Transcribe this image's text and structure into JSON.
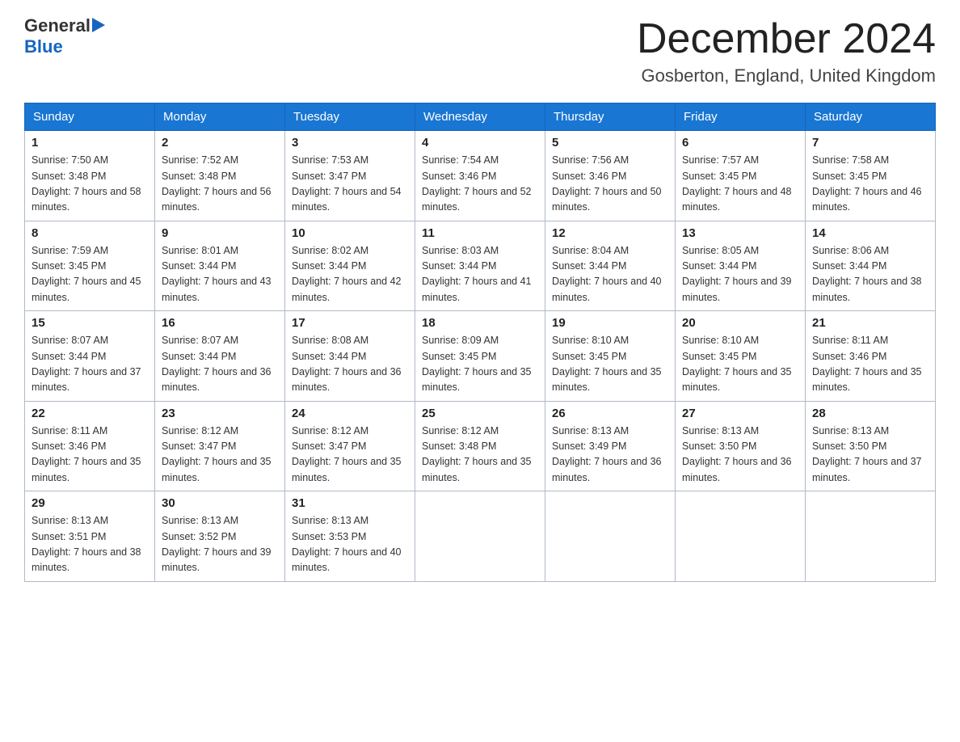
{
  "header": {
    "logo_general": "General",
    "logo_blue": "Blue",
    "month_title": "December 2024",
    "location": "Gosberton, England, United Kingdom"
  },
  "days_of_week": [
    "Sunday",
    "Monday",
    "Tuesday",
    "Wednesday",
    "Thursday",
    "Friday",
    "Saturday"
  ],
  "weeks": [
    [
      {
        "day": "1",
        "sunrise": "Sunrise: 7:50 AM",
        "sunset": "Sunset: 3:48 PM",
        "daylight": "Daylight: 7 hours and 58 minutes."
      },
      {
        "day": "2",
        "sunrise": "Sunrise: 7:52 AM",
        "sunset": "Sunset: 3:48 PM",
        "daylight": "Daylight: 7 hours and 56 minutes."
      },
      {
        "day": "3",
        "sunrise": "Sunrise: 7:53 AM",
        "sunset": "Sunset: 3:47 PM",
        "daylight": "Daylight: 7 hours and 54 minutes."
      },
      {
        "day": "4",
        "sunrise": "Sunrise: 7:54 AM",
        "sunset": "Sunset: 3:46 PM",
        "daylight": "Daylight: 7 hours and 52 minutes."
      },
      {
        "day": "5",
        "sunrise": "Sunrise: 7:56 AM",
        "sunset": "Sunset: 3:46 PM",
        "daylight": "Daylight: 7 hours and 50 minutes."
      },
      {
        "day": "6",
        "sunrise": "Sunrise: 7:57 AM",
        "sunset": "Sunset: 3:45 PM",
        "daylight": "Daylight: 7 hours and 48 minutes."
      },
      {
        "day": "7",
        "sunrise": "Sunrise: 7:58 AM",
        "sunset": "Sunset: 3:45 PM",
        "daylight": "Daylight: 7 hours and 46 minutes."
      }
    ],
    [
      {
        "day": "8",
        "sunrise": "Sunrise: 7:59 AM",
        "sunset": "Sunset: 3:45 PM",
        "daylight": "Daylight: 7 hours and 45 minutes."
      },
      {
        "day": "9",
        "sunrise": "Sunrise: 8:01 AM",
        "sunset": "Sunset: 3:44 PM",
        "daylight": "Daylight: 7 hours and 43 minutes."
      },
      {
        "day": "10",
        "sunrise": "Sunrise: 8:02 AM",
        "sunset": "Sunset: 3:44 PM",
        "daylight": "Daylight: 7 hours and 42 minutes."
      },
      {
        "day": "11",
        "sunrise": "Sunrise: 8:03 AM",
        "sunset": "Sunset: 3:44 PM",
        "daylight": "Daylight: 7 hours and 41 minutes."
      },
      {
        "day": "12",
        "sunrise": "Sunrise: 8:04 AM",
        "sunset": "Sunset: 3:44 PM",
        "daylight": "Daylight: 7 hours and 40 minutes."
      },
      {
        "day": "13",
        "sunrise": "Sunrise: 8:05 AM",
        "sunset": "Sunset: 3:44 PM",
        "daylight": "Daylight: 7 hours and 39 minutes."
      },
      {
        "day": "14",
        "sunrise": "Sunrise: 8:06 AM",
        "sunset": "Sunset: 3:44 PM",
        "daylight": "Daylight: 7 hours and 38 minutes."
      }
    ],
    [
      {
        "day": "15",
        "sunrise": "Sunrise: 8:07 AM",
        "sunset": "Sunset: 3:44 PM",
        "daylight": "Daylight: 7 hours and 37 minutes."
      },
      {
        "day": "16",
        "sunrise": "Sunrise: 8:07 AM",
        "sunset": "Sunset: 3:44 PM",
        "daylight": "Daylight: 7 hours and 36 minutes."
      },
      {
        "day": "17",
        "sunrise": "Sunrise: 8:08 AM",
        "sunset": "Sunset: 3:44 PM",
        "daylight": "Daylight: 7 hours and 36 minutes."
      },
      {
        "day": "18",
        "sunrise": "Sunrise: 8:09 AM",
        "sunset": "Sunset: 3:45 PM",
        "daylight": "Daylight: 7 hours and 35 minutes."
      },
      {
        "day": "19",
        "sunrise": "Sunrise: 8:10 AM",
        "sunset": "Sunset: 3:45 PM",
        "daylight": "Daylight: 7 hours and 35 minutes."
      },
      {
        "day": "20",
        "sunrise": "Sunrise: 8:10 AM",
        "sunset": "Sunset: 3:45 PM",
        "daylight": "Daylight: 7 hours and 35 minutes."
      },
      {
        "day": "21",
        "sunrise": "Sunrise: 8:11 AM",
        "sunset": "Sunset: 3:46 PM",
        "daylight": "Daylight: 7 hours and 35 minutes."
      }
    ],
    [
      {
        "day": "22",
        "sunrise": "Sunrise: 8:11 AM",
        "sunset": "Sunset: 3:46 PM",
        "daylight": "Daylight: 7 hours and 35 minutes."
      },
      {
        "day": "23",
        "sunrise": "Sunrise: 8:12 AM",
        "sunset": "Sunset: 3:47 PM",
        "daylight": "Daylight: 7 hours and 35 minutes."
      },
      {
        "day": "24",
        "sunrise": "Sunrise: 8:12 AM",
        "sunset": "Sunset: 3:47 PM",
        "daylight": "Daylight: 7 hours and 35 minutes."
      },
      {
        "day": "25",
        "sunrise": "Sunrise: 8:12 AM",
        "sunset": "Sunset: 3:48 PM",
        "daylight": "Daylight: 7 hours and 35 minutes."
      },
      {
        "day": "26",
        "sunrise": "Sunrise: 8:13 AM",
        "sunset": "Sunset: 3:49 PM",
        "daylight": "Daylight: 7 hours and 36 minutes."
      },
      {
        "day": "27",
        "sunrise": "Sunrise: 8:13 AM",
        "sunset": "Sunset: 3:50 PM",
        "daylight": "Daylight: 7 hours and 36 minutes."
      },
      {
        "day": "28",
        "sunrise": "Sunrise: 8:13 AM",
        "sunset": "Sunset: 3:50 PM",
        "daylight": "Daylight: 7 hours and 37 minutes."
      }
    ],
    [
      {
        "day": "29",
        "sunrise": "Sunrise: 8:13 AM",
        "sunset": "Sunset: 3:51 PM",
        "daylight": "Daylight: 7 hours and 38 minutes."
      },
      {
        "day": "30",
        "sunrise": "Sunrise: 8:13 AM",
        "sunset": "Sunset: 3:52 PM",
        "daylight": "Daylight: 7 hours and 39 minutes."
      },
      {
        "day": "31",
        "sunrise": "Sunrise: 8:13 AM",
        "sunset": "Sunset: 3:53 PM",
        "daylight": "Daylight: 7 hours and 40 minutes."
      },
      null,
      null,
      null,
      null
    ]
  ]
}
